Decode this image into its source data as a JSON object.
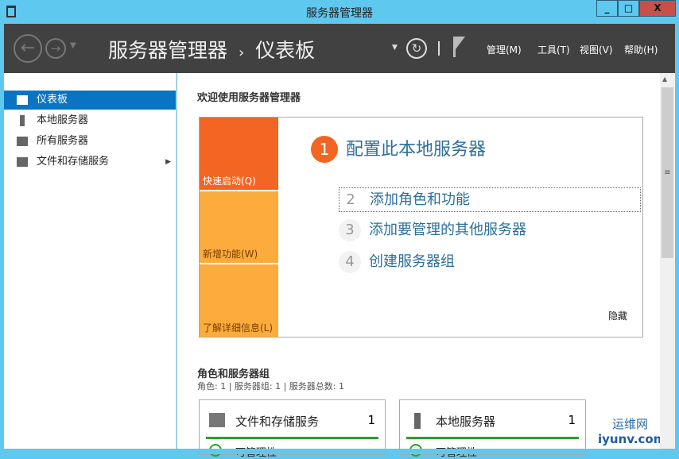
{
  "window": {
    "title": "服务器管理器",
    "minimize": "_",
    "maximize": "□",
    "close": "X"
  },
  "header": {
    "breadcrumb_root": "服务器管理器",
    "breadcrumb_sep": "›",
    "breadcrumb_current": "仪表板",
    "menus": [
      "管理(M)",
      "工具(T)",
      "视图(V)",
      "帮助(H)"
    ]
  },
  "sidebar": {
    "items": [
      {
        "label": "仪表板",
        "selected": true
      },
      {
        "label": "本地服务器"
      },
      {
        "label": "所有服务器"
      },
      {
        "label": "文件和存储服务"
      }
    ]
  },
  "welcome": {
    "heading": "欢迎使用服务器管理器",
    "tiles": [
      "快速启动(Q)",
      "新增功能(W)",
      "了解详细信息(L)"
    ],
    "steps": [
      {
        "num": "1",
        "label": "配置此本地服务器"
      },
      {
        "num": "2",
        "label": "添加角色和功能"
      },
      {
        "num": "3",
        "label": "添加要管理的其他服务器"
      },
      {
        "num": "4",
        "label": "创建服务器组"
      }
    ],
    "hide": "隐藏"
  },
  "roles": {
    "heading": "角色和服务器组",
    "summary": "角色: 1 | 服务器组: 1 | 服务器总数: 1",
    "cards": [
      {
        "title": "文件和存储服务",
        "count": "1",
        "status": "可管理性"
      },
      {
        "title": "本地服务器",
        "count": "1",
        "status": "可管理性"
      }
    ]
  },
  "watermark": {
    "text": "运维网",
    "url": "iyunv.com"
  }
}
